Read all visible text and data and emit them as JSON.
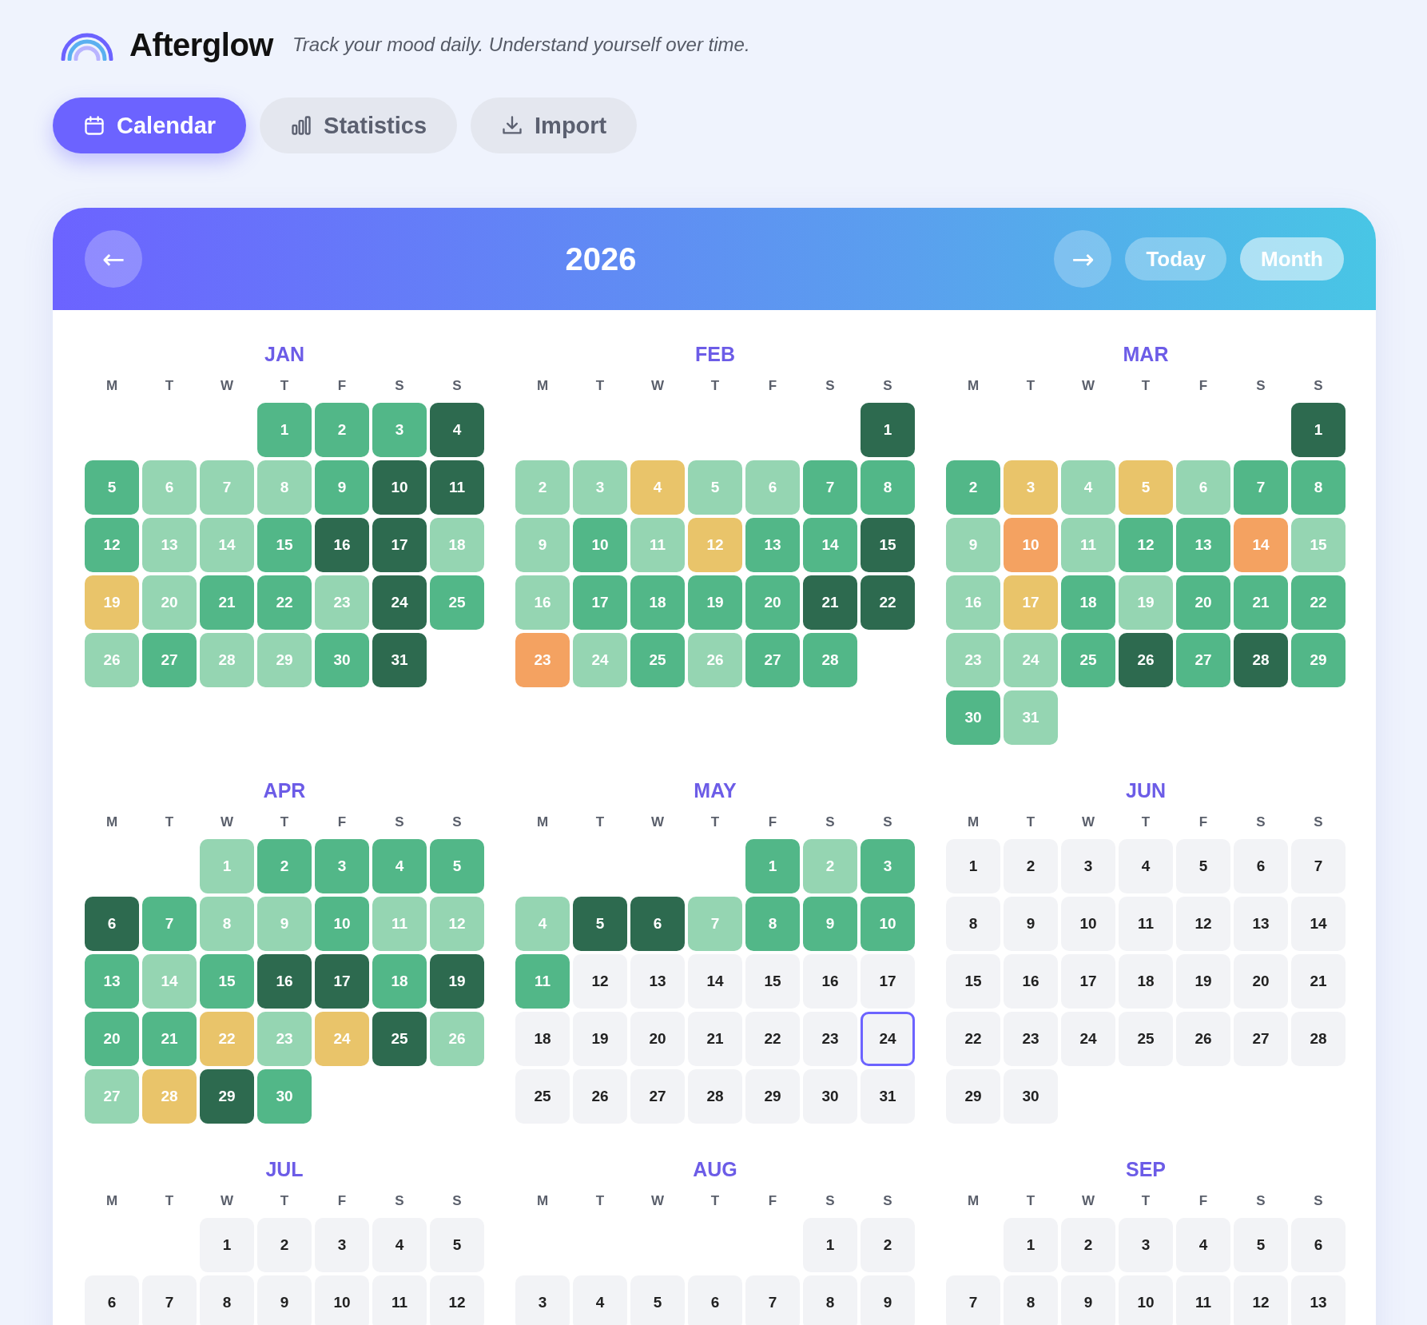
{
  "app": {
    "name": "Afterglow",
    "tagline": "Track your mood daily. Understand yourself over time."
  },
  "tabs": [
    {
      "label": "Calendar",
      "kind": "calendar",
      "selected": true
    },
    {
      "label": "Statistics",
      "kind": "stats",
      "selected": false
    },
    {
      "label": "Import",
      "kind": "import",
      "selected": false
    }
  ],
  "calendar": {
    "year": "2026",
    "prev": "←",
    "next": "→",
    "view_buttons": [
      {
        "label": "Today",
        "selected": false
      },
      {
        "label": "Month",
        "selected": true
      }
    ],
    "months": [
      {
        "name": "JAN",
        "weekdays": [
          "M",
          "T",
          "W",
          "T",
          "F",
          "S",
          "S"
        ],
        "days": [
          {
            "kind": "blank"
          },
          {
            "kind": "blank"
          },
          {
            "kind": "blank"
          },
          {
            "kind": "day",
            "day": "1",
            "color": "#52b788"
          },
          {
            "kind": "day",
            "day": "2",
            "color": "#52b788"
          },
          {
            "kind": "day",
            "day": "3",
            "color": "#52b788"
          },
          {
            "kind": "day",
            "day": "4",
            "color": "#2d6a4f"
          },
          {
            "kind": "day",
            "day": "5",
            "color": "#52b788"
          },
          {
            "kind": "day",
            "day": "6",
            "color": "#95d5b2"
          },
          {
            "kind": "day",
            "day": "7",
            "color": "#95d5b2"
          },
          {
            "kind": "day",
            "day": "8",
            "color": "#95d5b2"
          },
          {
            "kind": "day",
            "day": "9",
            "color": "#52b788"
          },
          {
            "kind": "day",
            "day": "10",
            "color": "#2d6a4f"
          },
          {
            "kind": "day",
            "day": "11",
            "color": "#2d6a4f"
          },
          {
            "kind": "day",
            "day": "12",
            "color": "#52b788"
          },
          {
            "kind": "day",
            "day": "13",
            "color": "#95d5b2"
          },
          {
            "kind": "day",
            "day": "14",
            "color": "#95d5b2"
          },
          {
            "kind": "day",
            "day": "15",
            "color": "#52b788"
          },
          {
            "kind": "day",
            "day": "16",
            "color": "#2d6a4f"
          },
          {
            "kind": "day",
            "day": "17",
            "color": "#2d6a4f"
          },
          {
            "kind": "day",
            "day": "18",
            "color": "#95d5b2"
          },
          {
            "kind": "day",
            "day": "19",
            "color": "#e9c46a"
          },
          {
            "kind": "day",
            "day": "20",
            "color": "#95d5b2"
          },
          {
            "kind": "day",
            "day": "21",
            "color": "#52b788"
          },
          {
            "kind": "day",
            "day": "22",
            "color": "#52b788"
          },
          {
            "kind": "day",
            "day": "23",
            "color": "#95d5b2"
          },
          {
            "kind": "day",
            "day": "24",
            "color": "#2d6a4f"
          },
          {
            "kind": "day",
            "day": "25",
            "color": "#52b788"
          },
          {
            "kind": "day",
            "day": "26",
            "color": "#95d5b2"
          },
          {
            "kind": "day",
            "day": "27",
            "color": "#52b788"
          },
          {
            "kind": "day",
            "day": "28",
            "color": "#95d5b2"
          },
          {
            "kind": "day",
            "day": "29",
            "color": "#95d5b2"
          },
          {
            "kind": "day",
            "day": "30",
            "color": "#52b788"
          },
          {
            "kind": "day",
            "day": "31",
            "color": "#2d6a4f"
          }
        ]
      },
      {
        "name": "FEB",
        "weekdays": [
          "M",
          "T",
          "W",
          "T",
          "F",
          "S",
          "S"
        ],
        "days": [
          {
            "kind": "blank"
          },
          {
            "kind": "blank"
          },
          {
            "kind": "blank"
          },
          {
            "kind": "blank"
          },
          {
            "kind": "blank"
          },
          {
            "kind": "blank"
          },
          {
            "kind": "day",
            "day": "1",
            "color": "#2d6a4f"
          },
          {
            "kind": "day",
            "day": "2",
            "color": "#95d5b2"
          },
          {
            "kind": "day",
            "day": "3",
            "color": "#95d5b2"
          },
          {
            "kind": "day",
            "day": "4",
            "color": "#e9c46a"
          },
          {
            "kind": "day",
            "day": "5",
            "color": "#95d5b2"
          },
          {
            "kind": "day",
            "day": "6",
            "color": "#95d5b2"
          },
          {
            "kind": "day",
            "day": "7",
            "color": "#52b788"
          },
          {
            "kind": "day",
            "day": "8",
            "color": "#52b788"
          },
          {
            "kind": "day",
            "day": "9",
            "color": "#95d5b2"
          },
          {
            "kind": "day",
            "day": "10",
            "color": "#52b788"
          },
          {
            "kind": "day",
            "day": "11",
            "color": "#95d5b2"
          },
          {
            "kind": "day",
            "day": "12",
            "color": "#e9c46a"
          },
          {
            "kind": "day",
            "day": "13",
            "color": "#52b788"
          },
          {
            "kind": "day",
            "day": "14",
            "color": "#52b788"
          },
          {
            "kind": "day",
            "day": "15",
            "color": "#2d6a4f"
          },
          {
            "kind": "day",
            "day": "16",
            "color": "#95d5b2"
          },
          {
            "kind": "day",
            "day": "17",
            "color": "#52b788"
          },
          {
            "kind": "day",
            "day": "18",
            "color": "#52b788"
          },
          {
            "kind": "day",
            "day": "19",
            "color": "#52b788"
          },
          {
            "kind": "day",
            "day": "20",
            "color": "#52b788"
          },
          {
            "kind": "day",
            "day": "21",
            "color": "#2d6a4f"
          },
          {
            "kind": "day",
            "day": "22",
            "color": "#2d6a4f"
          },
          {
            "kind": "day",
            "day": "23",
            "color": "#f4a261"
          },
          {
            "kind": "day",
            "day": "24",
            "color": "#95d5b2"
          },
          {
            "kind": "day",
            "day": "25",
            "color": "#52b788"
          },
          {
            "kind": "day",
            "day": "26",
            "color": "#95d5b2"
          },
          {
            "kind": "day",
            "day": "27",
            "color": "#52b788"
          },
          {
            "kind": "day",
            "day": "28",
            "color": "#52b788"
          }
        ]
      },
      {
        "name": "MAR",
        "weekdays": [
          "M",
          "T",
          "W",
          "T",
          "F",
          "S",
          "S"
        ],
        "days": [
          {
            "kind": "blank"
          },
          {
            "kind": "blank"
          },
          {
            "kind": "blank"
          },
          {
            "kind": "blank"
          },
          {
            "kind": "blank"
          },
          {
            "kind": "blank"
          },
          {
            "kind": "day",
            "day": "1",
            "color": "#2d6a4f"
          },
          {
            "kind": "day",
            "day": "2",
            "color": "#52b788"
          },
          {
            "kind": "day",
            "day": "3",
            "color": "#e9c46a"
          },
          {
            "kind": "day",
            "day": "4",
            "color": "#95d5b2"
          },
          {
            "kind": "day",
            "day": "5",
            "color": "#e9c46a"
          },
          {
            "kind": "day",
            "day": "6",
            "color": "#95d5b2"
          },
          {
            "kind": "day",
            "day": "7",
            "color": "#52b788"
          },
          {
            "kind": "day",
            "day": "8",
            "color": "#52b788"
          },
          {
            "kind": "day",
            "day": "9",
            "color": "#95d5b2"
          },
          {
            "kind": "day",
            "day": "10",
            "color": "#f4a261"
          },
          {
            "kind": "day",
            "day": "11",
            "color": "#95d5b2"
          },
          {
            "kind": "day",
            "day": "12",
            "color": "#52b788"
          },
          {
            "kind": "day",
            "day": "13",
            "color": "#52b788"
          },
          {
            "kind": "day",
            "day": "14",
            "color": "#f4a261"
          },
          {
            "kind": "day",
            "day": "15",
            "color": "#95d5b2"
          },
          {
            "kind": "day",
            "day": "16",
            "color": "#95d5b2"
          },
          {
            "kind": "day",
            "day": "17",
            "color": "#e9c46a"
          },
          {
            "kind": "day",
            "day": "18",
            "color": "#52b788"
          },
          {
            "kind": "day",
            "day": "19",
            "color": "#95d5b2"
          },
          {
            "kind": "day",
            "day": "20",
            "color": "#52b788"
          },
          {
            "kind": "day",
            "day": "21",
            "color": "#52b788"
          },
          {
            "kind": "day",
            "day": "22",
            "color": "#52b788"
          },
          {
            "kind": "day",
            "day": "23",
            "color": "#95d5b2"
          },
          {
            "kind": "day",
            "day": "24",
            "color": "#95d5b2"
          },
          {
            "kind": "day",
            "day": "25",
            "color": "#52b788"
          },
          {
            "kind": "day",
            "day": "26",
            "color": "#2d6a4f"
          },
          {
            "kind": "day",
            "day": "27",
            "color": "#52b788"
          },
          {
            "kind": "day",
            "day": "28",
            "color": "#2d6a4f"
          },
          {
            "kind": "day",
            "day": "29",
            "color": "#52b788"
          },
          {
            "kind": "day",
            "day": "30",
            "color": "#52b788"
          },
          {
            "kind": "day",
            "day": "31",
            "color": "#95d5b2"
          }
        ]
      },
      {
        "name": "APR",
        "weekdays": [
          "M",
          "T",
          "W",
          "T",
          "F",
          "S",
          "S"
        ],
        "days": [
          {
            "kind": "blank"
          },
          {
            "kind": "blank"
          },
          {
            "kind": "day",
            "day": "1",
            "color": "#95d5b2"
          },
          {
            "kind": "day",
            "day": "2",
            "color": "#52b788"
          },
          {
            "kind": "day",
            "day": "3",
            "color": "#52b788"
          },
          {
            "kind": "day",
            "day": "4",
            "color": "#52b788"
          },
          {
            "kind": "day",
            "day": "5",
            "color": "#52b788"
          },
          {
            "kind": "day",
            "day": "6",
            "color": "#2d6a4f"
          },
          {
            "kind": "day",
            "day": "7",
            "color": "#52b788"
          },
          {
            "kind": "day",
            "day": "8",
            "color": "#95d5b2"
          },
          {
            "kind": "day",
            "day": "9",
            "color": "#95d5b2"
          },
          {
            "kind": "day",
            "day": "10",
            "color": "#52b788"
          },
          {
            "kind": "day",
            "day": "11",
            "color": "#95d5b2"
          },
          {
            "kind": "day",
            "day": "12",
            "color": "#95d5b2"
          },
          {
            "kind": "day",
            "day": "13",
            "color": "#52b788"
          },
          {
            "kind": "day",
            "day": "14",
            "color": "#95d5b2"
          },
          {
            "kind": "day",
            "day": "15",
            "color": "#52b788"
          },
          {
            "kind": "day",
            "day": "16",
            "color": "#2d6a4f"
          },
          {
            "kind": "day",
            "day": "17",
            "color": "#2d6a4f"
          },
          {
            "kind": "day",
            "day": "18",
            "color": "#52b788"
          },
          {
            "kind": "day",
            "day": "19",
            "color": "#2d6a4f"
          },
          {
            "kind": "day",
            "day": "20",
            "color": "#52b788"
          },
          {
            "kind": "day",
            "day": "21",
            "color": "#52b788"
          },
          {
            "kind": "day",
            "day": "22",
            "color": "#e9c46a"
          },
          {
            "kind": "day",
            "day": "23",
            "color": "#95d5b2"
          },
          {
            "kind": "day",
            "day": "24",
            "color": "#e9c46a"
          },
          {
            "kind": "day",
            "day": "25",
            "color": "#2d6a4f"
          },
          {
            "kind": "day",
            "day": "26",
            "color": "#95d5b2"
          },
          {
            "kind": "day",
            "day": "27",
            "color": "#95d5b2"
          },
          {
            "kind": "day",
            "day": "28",
            "color": "#e9c46a"
          },
          {
            "kind": "day",
            "day": "29",
            "color": "#2d6a4f"
          },
          {
            "kind": "day",
            "day": "30",
            "color": "#52b788"
          }
        ]
      },
      {
        "name": "MAY",
        "weekdays": [
          "M",
          "T",
          "W",
          "T",
          "F",
          "S",
          "S"
        ],
        "days": [
          {
            "kind": "blank"
          },
          {
            "kind": "blank"
          },
          {
            "kind": "blank"
          },
          {
            "kind": "blank"
          },
          {
            "kind": "day",
            "day": "1",
            "color": "#52b788"
          },
          {
            "kind": "day",
            "day": "2",
            "color": "#95d5b2"
          },
          {
            "kind": "day",
            "day": "3",
            "color": "#52b788"
          },
          {
            "kind": "day",
            "day": "4",
            "color": "#95d5b2"
          },
          {
            "kind": "day",
            "day": "5",
            "color": "#2d6a4f"
          },
          {
            "kind": "day",
            "day": "6",
            "color": "#2d6a4f"
          },
          {
            "kind": "day",
            "day": "7",
            "color": "#95d5b2"
          },
          {
            "kind": "day",
            "day": "8",
            "color": "#52b788"
          },
          {
            "kind": "day",
            "day": "9",
            "color": "#52b788"
          },
          {
            "kind": "day",
            "day": "10",
            "color": "#52b788"
          },
          {
            "kind": "day",
            "day": "11",
            "color": "#52b788"
          },
          {
            "kind": "day",
            "day": "12",
            "color": "#f2f3f6"
          },
          {
            "kind": "day",
            "day": "13",
            "color": "#f2f3f6"
          },
          {
            "kind": "day",
            "day": "14",
            "color": "#f2f3f6"
          },
          {
            "kind": "day",
            "day": "15",
            "color": "#f2f3f6"
          },
          {
            "kind": "day",
            "day": "16",
            "color": "#f2f3f6"
          },
          {
            "kind": "day",
            "day": "17",
            "color": "#f2f3f6"
          },
          {
            "kind": "day",
            "day": "18",
            "color": "#f2f3f6"
          },
          {
            "kind": "day",
            "day": "19",
            "color": "#f2f3f6"
          },
          {
            "kind": "day",
            "day": "20",
            "color": "#f2f3f6"
          },
          {
            "kind": "day",
            "day": "21",
            "color": "#f2f3f6"
          },
          {
            "kind": "day",
            "day": "22",
            "color": "#f2f3f6"
          },
          {
            "kind": "day",
            "day": "23",
            "color": "#f2f3f6"
          },
          {
            "kind": "today",
            "day": "24",
            "color": "#f2f3f6"
          },
          {
            "kind": "day",
            "day": "25",
            "color": "#f2f3f6"
          },
          {
            "kind": "day",
            "day": "26",
            "color": "#f2f3f6"
          },
          {
            "kind": "day",
            "day": "27",
            "color": "#f2f3f6"
          },
          {
            "kind": "day",
            "day": "28",
            "color": "#f2f3f6"
          },
          {
            "kind": "day",
            "day": "29",
            "color": "#f2f3f6"
          },
          {
            "kind": "day",
            "day": "30",
            "color": "#f2f3f6"
          },
          {
            "kind": "day",
            "day": "31",
            "color": "#f2f3f6"
          }
        ]
      },
      {
        "name": "JUN",
        "weekdays": [
          "M",
          "T",
          "W",
          "T",
          "F",
          "S",
          "S"
        ],
        "days": [
          {
            "kind": "day",
            "day": "1",
            "color": "#f2f3f6"
          },
          {
            "kind": "day",
            "day": "2",
            "color": "#f2f3f6"
          },
          {
            "kind": "day",
            "day": "3",
            "color": "#f2f3f6"
          },
          {
            "kind": "day",
            "day": "4",
            "color": "#f2f3f6"
          },
          {
            "kind": "day",
            "day": "5",
            "color": "#f2f3f6"
          },
          {
            "kind": "day",
            "day": "6",
            "color": "#f2f3f6"
          },
          {
            "kind": "day",
            "day": "7",
            "color": "#f2f3f6"
          },
          {
            "kind": "day",
            "day": "8",
            "color": "#f2f3f6"
          },
          {
            "kind": "day",
            "day": "9",
            "color": "#f2f3f6"
          },
          {
            "kind": "day",
            "day": "10",
            "color": "#f2f3f6"
          },
          {
            "kind": "day",
            "day": "11",
            "color": "#f2f3f6"
          },
          {
            "kind": "day",
            "day": "12",
            "color": "#f2f3f6"
          },
          {
            "kind": "day",
            "day": "13",
            "color": "#f2f3f6"
          },
          {
            "kind": "day",
            "day": "14",
            "color": "#f2f3f6"
          },
          {
            "kind": "day",
            "day": "15",
            "color": "#f2f3f6"
          },
          {
            "kind": "day",
            "day": "16",
            "color": "#f2f3f6"
          },
          {
            "kind": "day",
            "day": "17",
            "color": "#f2f3f6"
          },
          {
            "kind": "day",
            "day": "18",
            "color": "#f2f3f6"
          },
          {
            "kind": "day",
            "day": "19",
            "color": "#f2f3f6"
          },
          {
            "kind": "day",
            "day": "20",
            "color": "#f2f3f6"
          },
          {
            "kind": "day",
            "day": "21",
            "color": "#f2f3f6"
          },
          {
            "kind": "day",
            "day": "22",
            "color": "#f2f3f6"
          },
          {
            "kind": "day",
            "day": "23",
            "color": "#f2f3f6"
          },
          {
            "kind": "day",
            "day": "24",
            "color": "#f2f3f6"
          },
          {
            "kind": "day",
            "day": "25",
            "color": "#f2f3f6"
          },
          {
            "kind": "day",
            "day": "26",
            "color": "#f2f3f6"
          },
          {
            "kind": "day",
            "day": "27",
            "color": "#f2f3f6"
          },
          {
            "kind": "day",
            "day": "28",
            "color": "#f2f3f6"
          },
          {
            "kind": "day",
            "day": "29",
            "color": "#f2f3f6"
          },
          {
            "kind": "day",
            "day": "30",
            "color": "#f2f3f6"
          }
        ]
      },
      {
        "name": "JUL",
        "weekdays": [
          "M",
          "T",
          "W",
          "T",
          "F",
          "S",
          "S"
        ],
        "days": [
          {
            "kind": "blank"
          },
          {
            "kind": "blank"
          },
          {
            "kind": "day",
            "day": "1",
            "color": "#f2f3f6"
          },
          {
            "kind": "day",
            "day": "2",
            "color": "#f2f3f6"
          },
          {
            "kind": "day",
            "day": "3",
            "color": "#f2f3f6"
          },
          {
            "kind": "day",
            "day": "4",
            "color": "#f2f3f6"
          },
          {
            "kind": "day",
            "day": "5",
            "color": "#f2f3f6"
          },
          {
            "kind": "day",
            "day": "6",
            "color": "#f2f3f6"
          },
          {
            "kind": "day",
            "day": "7",
            "color": "#f2f3f6"
          },
          {
            "kind": "day",
            "day": "8",
            "color": "#f2f3f6"
          },
          {
            "kind": "day",
            "day": "9",
            "color": "#f2f3f6"
          },
          {
            "kind": "day",
            "day": "10",
            "color": "#f2f3f6"
          },
          {
            "kind": "day",
            "day": "11",
            "color": "#f2f3f6"
          },
          {
            "kind": "day",
            "day": "12",
            "color": "#f2f3f6"
          }
        ]
      },
      {
        "name": "AUG",
        "weekdays": [
          "M",
          "T",
          "W",
          "T",
          "F",
          "S",
          "S"
        ],
        "days": [
          {
            "kind": "blank"
          },
          {
            "kind": "blank"
          },
          {
            "kind": "blank"
          },
          {
            "kind": "blank"
          },
          {
            "kind": "blank"
          },
          {
            "kind": "day",
            "day": "1",
            "color": "#f2f3f6"
          },
          {
            "kind": "day",
            "day": "2",
            "color": "#f2f3f6"
          },
          {
            "kind": "day",
            "day": "3",
            "color": "#f2f3f6"
          },
          {
            "kind": "day",
            "day": "4",
            "color": "#f2f3f6"
          },
          {
            "kind": "day",
            "day": "5",
            "color": "#f2f3f6"
          },
          {
            "kind": "day",
            "day": "6",
            "color": "#f2f3f6"
          },
          {
            "kind": "day",
            "day": "7",
            "color": "#f2f3f6"
          },
          {
            "kind": "day",
            "day": "8",
            "color": "#f2f3f6"
          },
          {
            "kind": "day",
            "day": "9",
            "color": "#f2f3f6"
          }
        ]
      },
      {
        "name": "SEP",
        "weekdays": [
          "M",
          "T",
          "W",
          "T",
          "F",
          "S",
          "S"
        ],
        "days": [
          {
            "kind": "blank"
          },
          {
            "kind": "day",
            "day": "1",
            "color": "#f2f3f6"
          },
          {
            "kind": "day",
            "day": "2",
            "color": "#f2f3f6"
          },
          {
            "kind": "day",
            "day": "3",
            "color": "#f2f3f6"
          },
          {
            "kind": "day",
            "day": "4",
            "color": "#f2f3f6"
          },
          {
            "kind": "day",
            "day": "5",
            "color": "#f2f3f6"
          },
          {
            "kind": "day",
            "day": "6",
            "color": "#f2f3f6"
          },
          {
            "kind": "day",
            "day": "7",
            "color": "#f2f3f6"
          },
          {
            "kind": "day",
            "day": "8",
            "color": "#f2f3f6"
          },
          {
            "kind": "day",
            "day": "9",
            "color": "#f2f3f6"
          },
          {
            "kind": "day",
            "day": "10",
            "color": "#f2f3f6"
          },
          {
            "kind": "day",
            "day": "11",
            "color": "#f2f3f6"
          },
          {
            "kind": "day",
            "day": "12",
            "color": "#f2f3f6"
          },
          {
            "kind": "day",
            "day": "13",
            "color": "#f2f3f6"
          }
        ]
      }
    ]
  }
}
